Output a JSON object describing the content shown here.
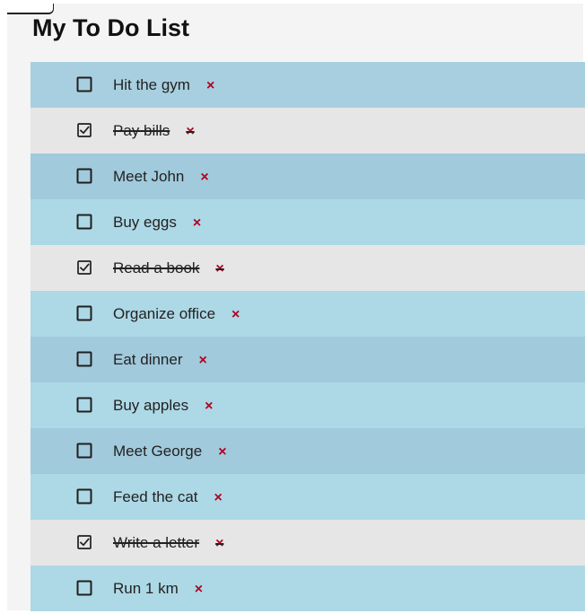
{
  "page": {
    "title": "My To Do List"
  },
  "theme": {
    "row_colors": [
      "#a7cfe0",
      "#e6e6e6",
      "#a1cadc",
      "#add8e6",
      "#e6e6e6",
      "#add8e6",
      "#a1cadc",
      "#add8e6",
      "#a1cadc",
      "#add8e6",
      "#e6e6e6",
      "#add8e6"
    ],
    "delete_color": "#b3001f"
  },
  "tasks": [
    {
      "text": "Hit the gym",
      "completed": false,
      "checkbox_icon": "checkbox-empty-icon",
      "delete_label": "×"
    },
    {
      "text": "Pay bills",
      "completed": true,
      "checkbox_icon": "checkbox-checked-icon",
      "delete_label": "×"
    },
    {
      "text": "Meet John",
      "completed": false,
      "checkbox_icon": "checkbox-empty-icon",
      "delete_label": "×"
    },
    {
      "text": "Buy eggs",
      "completed": false,
      "checkbox_icon": "checkbox-empty-icon",
      "delete_label": "×"
    },
    {
      "text": "Read a book",
      "completed": true,
      "checkbox_icon": "checkbox-checked-icon",
      "delete_label": "×"
    },
    {
      "text": "Organize office",
      "completed": false,
      "checkbox_icon": "checkbox-empty-icon",
      "delete_label": "×"
    },
    {
      "text": "Eat dinner",
      "completed": false,
      "checkbox_icon": "checkbox-empty-icon",
      "delete_label": "×"
    },
    {
      "text": "Buy apples",
      "completed": false,
      "checkbox_icon": "checkbox-empty-icon",
      "delete_label": "×"
    },
    {
      "text": "Meet George",
      "completed": false,
      "checkbox_icon": "checkbox-empty-icon",
      "delete_label": "×"
    },
    {
      "text": "Feed the cat",
      "completed": false,
      "checkbox_icon": "checkbox-empty-icon",
      "delete_label": "×"
    },
    {
      "text": "Write a letter",
      "completed": true,
      "checkbox_icon": "checkbox-checked-icon",
      "delete_label": "×"
    },
    {
      "text": "Run 1 km",
      "completed": false,
      "checkbox_icon": "checkbox-empty-icon",
      "delete_label": "×"
    }
  ]
}
